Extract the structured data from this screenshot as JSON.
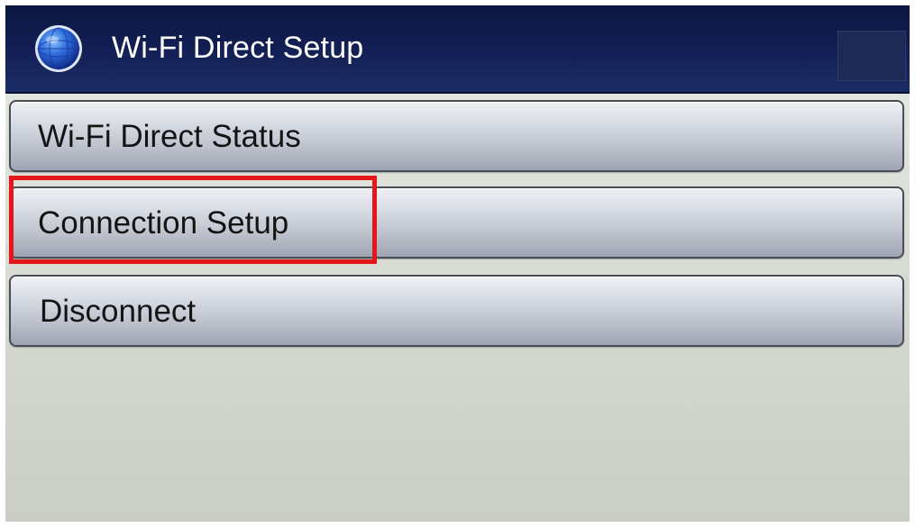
{
  "header": {
    "title": "Wi-Fi Direct Setup",
    "icon": "globe-icon"
  },
  "menu": {
    "items": [
      {
        "label": "Wi-Fi Direct Status"
      },
      {
        "label": "Connection Setup",
        "highlighted": true
      },
      {
        "label": "Disconnect"
      }
    ]
  },
  "colors": {
    "header_bg": "#121e52",
    "highlight": "#e3161b",
    "button_text": "#141414"
  }
}
